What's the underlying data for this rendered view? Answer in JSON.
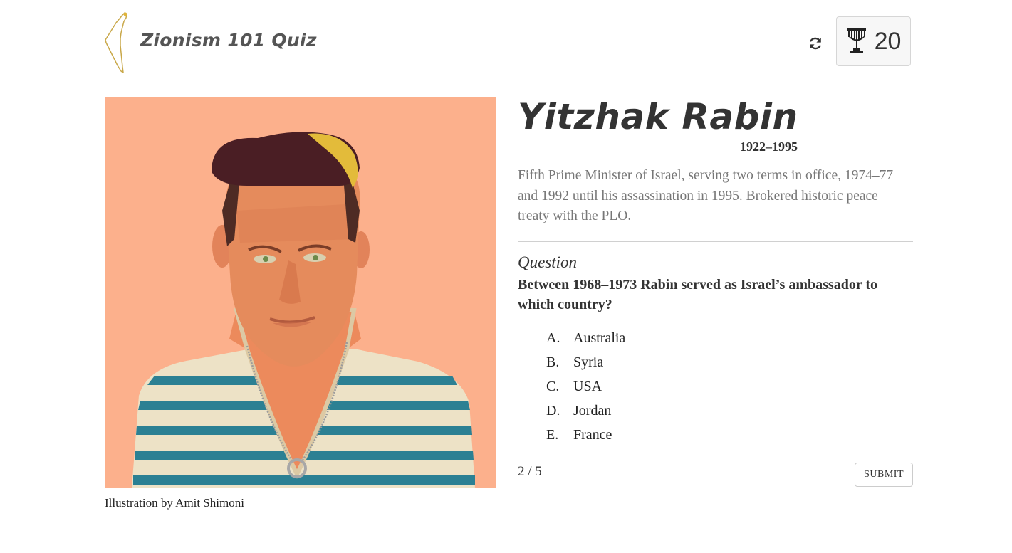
{
  "header": {
    "title": "Zionism 101 Quiz",
    "score": "20"
  },
  "person": {
    "name": "Yitzhak Rabin",
    "years": "1922–1995",
    "bio": "Fifth Prime Minister of Israel, serving two terms in office, 1974–77 and 1992 until his assassination in 1995. Brokered historic peace treaty with the PLO."
  },
  "illustration": {
    "caption": "Illustration by Amit Shimoni"
  },
  "question": {
    "heading": "Question",
    "text": "Between 1968–1973 Rabin served as Israel’s ambassador to which country?",
    "options": [
      {
        "letter": "A.",
        "label": "Australia"
      },
      {
        "letter": "B.",
        "label": "Syria"
      },
      {
        "letter": "C.",
        "label": "USA"
      },
      {
        "letter": "D.",
        "label": "Jordan"
      },
      {
        "letter": "E.",
        "label": "France"
      }
    ]
  },
  "footer": {
    "progress": "2 / 5",
    "submit_label": "SUBMIT"
  },
  "icons": {
    "logo": "israel-map-icon",
    "refresh": "refresh-icon",
    "score": "menorah-icon"
  },
  "colors": {
    "portrait_background": "#fcb08c",
    "title_text": "#555555",
    "bio_text": "#777777"
  }
}
